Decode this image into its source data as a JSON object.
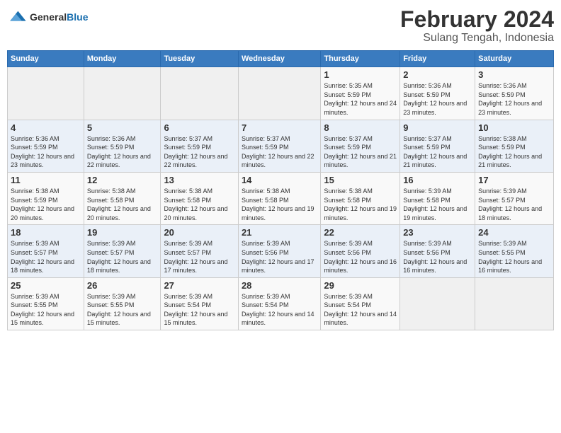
{
  "header": {
    "logo": {
      "general": "General",
      "blue": "Blue"
    },
    "title": "February 2024",
    "subtitle": "Sulang Tengah, Indonesia"
  },
  "calendar": {
    "days_of_week": [
      "Sunday",
      "Monday",
      "Tuesday",
      "Wednesday",
      "Thursday",
      "Friday",
      "Saturday"
    ],
    "weeks": [
      {
        "days": [
          {
            "num": "",
            "empty": true
          },
          {
            "num": "",
            "empty": true
          },
          {
            "num": "",
            "empty": true
          },
          {
            "num": "",
            "empty": true
          },
          {
            "num": "1",
            "sunrise": "Sunrise: 5:35 AM",
            "sunset": "Sunset: 5:59 PM",
            "daylight": "Daylight: 12 hours and 24 minutes."
          },
          {
            "num": "2",
            "sunrise": "Sunrise: 5:36 AM",
            "sunset": "Sunset: 5:59 PM",
            "daylight": "Daylight: 12 hours and 23 minutes."
          },
          {
            "num": "3",
            "sunrise": "Sunrise: 5:36 AM",
            "sunset": "Sunset: 5:59 PM",
            "daylight": "Daylight: 12 hours and 23 minutes."
          }
        ]
      },
      {
        "days": [
          {
            "num": "4",
            "sunrise": "Sunrise: 5:36 AM",
            "sunset": "Sunset: 5:59 PM",
            "daylight": "Daylight: 12 hours and 23 minutes."
          },
          {
            "num": "5",
            "sunrise": "Sunrise: 5:36 AM",
            "sunset": "Sunset: 5:59 PM",
            "daylight": "Daylight: 12 hours and 22 minutes."
          },
          {
            "num": "6",
            "sunrise": "Sunrise: 5:37 AM",
            "sunset": "Sunset: 5:59 PM",
            "daylight": "Daylight: 12 hours and 22 minutes."
          },
          {
            "num": "7",
            "sunrise": "Sunrise: 5:37 AM",
            "sunset": "Sunset: 5:59 PM",
            "daylight": "Daylight: 12 hours and 22 minutes."
          },
          {
            "num": "8",
            "sunrise": "Sunrise: 5:37 AM",
            "sunset": "Sunset: 5:59 PM",
            "daylight": "Daylight: 12 hours and 21 minutes."
          },
          {
            "num": "9",
            "sunrise": "Sunrise: 5:37 AM",
            "sunset": "Sunset: 5:59 PM",
            "daylight": "Daylight: 12 hours and 21 minutes."
          },
          {
            "num": "10",
            "sunrise": "Sunrise: 5:38 AM",
            "sunset": "Sunset: 5:59 PM",
            "daylight": "Daylight: 12 hours and 21 minutes."
          }
        ]
      },
      {
        "days": [
          {
            "num": "11",
            "sunrise": "Sunrise: 5:38 AM",
            "sunset": "Sunset: 5:59 PM",
            "daylight": "Daylight: 12 hours and 20 minutes."
          },
          {
            "num": "12",
            "sunrise": "Sunrise: 5:38 AM",
            "sunset": "Sunset: 5:58 PM",
            "daylight": "Daylight: 12 hours and 20 minutes."
          },
          {
            "num": "13",
            "sunrise": "Sunrise: 5:38 AM",
            "sunset": "Sunset: 5:58 PM",
            "daylight": "Daylight: 12 hours and 20 minutes."
          },
          {
            "num": "14",
            "sunrise": "Sunrise: 5:38 AM",
            "sunset": "Sunset: 5:58 PM",
            "daylight": "Daylight: 12 hours and 19 minutes."
          },
          {
            "num": "15",
            "sunrise": "Sunrise: 5:38 AM",
            "sunset": "Sunset: 5:58 PM",
            "daylight": "Daylight: 12 hours and 19 minutes."
          },
          {
            "num": "16",
            "sunrise": "Sunrise: 5:39 AM",
            "sunset": "Sunset: 5:58 PM",
            "daylight": "Daylight: 12 hours and 19 minutes."
          },
          {
            "num": "17",
            "sunrise": "Sunrise: 5:39 AM",
            "sunset": "Sunset: 5:57 PM",
            "daylight": "Daylight: 12 hours and 18 minutes."
          }
        ]
      },
      {
        "days": [
          {
            "num": "18",
            "sunrise": "Sunrise: 5:39 AM",
            "sunset": "Sunset: 5:57 PM",
            "daylight": "Daylight: 12 hours and 18 minutes."
          },
          {
            "num": "19",
            "sunrise": "Sunrise: 5:39 AM",
            "sunset": "Sunset: 5:57 PM",
            "daylight": "Daylight: 12 hours and 18 minutes."
          },
          {
            "num": "20",
            "sunrise": "Sunrise: 5:39 AM",
            "sunset": "Sunset: 5:57 PM",
            "daylight": "Daylight: 12 hours and 17 minutes."
          },
          {
            "num": "21",
            "sunrise": "Sunrise: 5:39 AM",
            "sunset": "Sunset: 5:56 PM",
            "daylight": "Daylight: 12 hours and 17 minutes."
          },
          {
            "num": "22",
            "sunrise": "Sunrise: 5:39 AM",
            "sunset": "Sunset: 5:56 PM",
            "daylight": "Daylight: 12 hours and 16 minutes."
          },
          {
            "num": "23",
            "sunrise": "Sunrise: 5:39 AM",
            "sunset": "Sunset: 5:56 PM",
            "daylight": "Daylight: 12 hours and 16 minutes."
          },
          {
            "num": "24",
            "sunrise": "Sunrise: 5:39 AM",
            "sunset": "Sunset: 5:55 PM",
            "daylight": "Daylight: 12 hours and 16 minutes."
          }
        ]
      },
      {
        "days": [
          {
            "num": "25",
            "sunrise": "Sunrise: 5:39 AM",
            "sunset": "Sunset: 5:55 PM",
            "daylight": "Daylight: 12 hours and 15 minutes."
          },
          {
            "num": "26",
            "sunrise": "Sunrise: 5:39 AM",
            "sunset": "Sunset: 5:55 PM",
            "daylight": "Daylight: 12 hours and 15 minutes."
          },
          {
            "num": "27",
            "sunrise": "Sunrise: 5:39 AM",
            "sunset": "Sunset: 5:54 PM",
            "daylight": "Daylight: 12 hours and 15 minutes."
          },
          {
            "num": "28",
            "sunrise": "Sunrise: 5:39 AM",
            "sunset": "Sunset: 5:54 PM",
            "daylight": "Daylight: 12 hours and 14 minutes."
          },
          {
            "num": "29",
            "sunrise": "Sunrise: 5:39 AM",
            "sunset": "Sunset: 5:54 PM",
            "daylight": "Daylight: 12 hours and 14 minutes."
          },
          {
            "num": "",
            "empty": true
          },
          {
            "num": "",
            "empty": true
          }
        ]
      }
    ]
  }
}
